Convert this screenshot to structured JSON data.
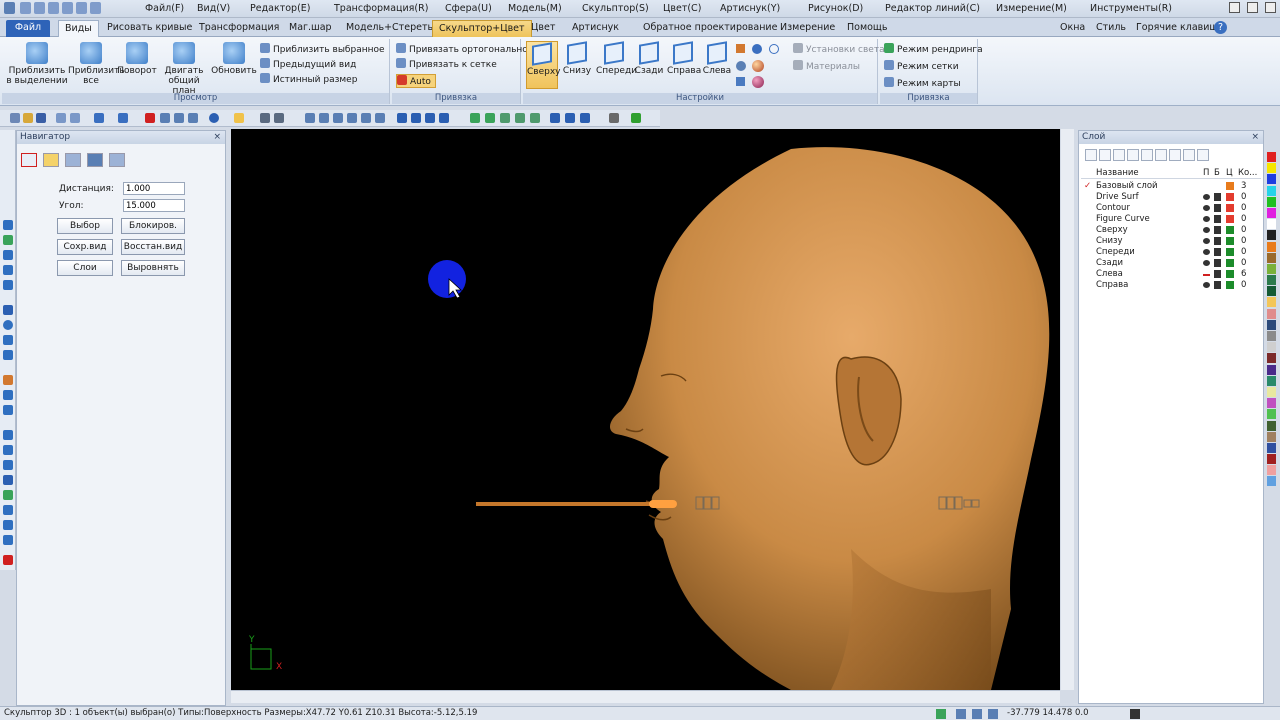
{
  "titlebar": {
    "menus": [
      "Файл(F)",
      "Вид(V)",
      "Редактор(E)",
      "Трансформация(R)",
      "Сфера(U)",
      "Модель(M)",
      "Скульптор(S)",
      "Цвет(C)",
      "Артиснук(Y)",
      "Рисунок(D)",
      "Редактор линий(C)",
      "Измерение(M)",
      "Инструменты(R)"
    ]
  },
  "ribbon_tabs": {
    "file": "Файл",
    "tabs": [
      "Виды",
      "Рисовать кривые",
      "Трансформация",
      "Маг.шар",
      "Модель+Стереть",
      "Скульптор+Цвет",
      "Цвет",
      "Артиснук",
      "Обратное проектирование",
      "Измерение",
      "Помощь"
    ],
    "right": [
      "Окна",
      "Стиль",
      "Горячие клавиши"
    ]
  },
  "ribbon": {
    "view_group": {
      "label": "Просмотр",
      "buttons": [
        "Приблизить в выделении",
        "Приблизить все",
        "Поворот",
        "Двигать общий план",
        "Обновить"
      ],
      "small": [
        "Приблизить выбранное",
        "Предыдущий вид",
        "Истинный размер"
      ]
    },
    "snap_group": {
      "label": "Привязка",
      "items": [
        "Привязать ортогонально",
        "Привязать к сетке",
        "Auto"
      ]
    },
    "settings_group": {
      "label": "Настройки",
      "views": [
        "Сверху",
        "Снизу",
        "Спереди",
        "Сзади",
        "Справа",
        "Слева"
      ],
      "small": [
        "Установки света",
        "Материалы"
      ]
    },
    "snap2_group": {
      "label": "Привязка",
      "items": [
        "Режим рендринга",
        "Режим сетки",
        "Режим карты"
      ]
    }
  },
  "navigator": {
    "title": "Навигатор",
    "distance_label": "Дистанция:",
    "distance_value": "1.000",
    "angle_label": "Угол:",
    "angle_value": "15.000",
    "buttons": [
      "Выбор",
      "Блокиров.",
      "Сохр.вид",
      "Восстан.вид",
      "Слои",
      "Выровнять"
    ]
  },
  "viewport": {
    "axis_y": "Y",
    "axis_x": "X"
  },
  "layers": {
    "title": "Слой",
    "headers": [
      "Название",
      "П",
      "Б",
      "Ц",
      "Ко..."
    ],
    "rows": [
      {
        "name": "Базовый слой",
        "color": "#e87b1c",
        "count": "3"
      },
      {
        "name": "Drive Surf",
        "color": "#e33b2e",
        "count": "0"
      },
      {
        "name": "Contour",
        "color": "#e33b2e",
        "count": "0"
      },
      {
        "name": "Figure Curve",
        "color": "#e33b2e",
        "count": "0"
      },
      {
        "name": "Сверху",
        "color": "#1c8c2a",
        "count": "0"
      },
      {
        "name": "Снизу",
        "color": "#1c8c2a",
        "count": "0"
      },
      {
        "name": "Спереди",
        "color": "#1c8c2a",
        "count": "0"
      },
      {
        "name": "Сзади",
        "color": "#1c8c2a",
        "count": "0"
      },
      {
        "name": "Слева",
        "color": "#1c8c2a",
        "count": "6"
      },
      {
        "name": "Справа",
        "color": "#1c8c2a",
        "count": "0"
      }
    ]
  },
  "palette": [
    "#e02020",
    "#f6e600",
    "#1f3de0",
    "#25d3e8",
    "#20c020",
    "#e020e0",
    "#ffffff",
    "#202020",
    "#e87b1c",
    "#9a6a2c",
    "#7ab13a",
    "#2c7a4c",
    "#155a35",
    "#f3c65a",
    "#e08c8c",
    "#2c4a7a",
    "#8b8b8b",
    "#cfcfcf",
    "#7c2a2a",
    "#4a2a8a",
    "#2a8a6a",
    "#e8e8a0",
    "#c050c0",
    "#50c050",
    "#406030",
    "#a08060",
    "#3050a0",
    "#a02020",
    "#f0a0a0",
    "#60a0e0"
  ],
  "status": {
    "left": "Скульптор 3D : 1 объект(ы) выбран(о) Типы:Поверхность  Размеры:X47.72 Y0.61 Z10.31 Высота:-5.12,5.19",
    "coords": "-37.779 14.478 0.0"
  }
}
